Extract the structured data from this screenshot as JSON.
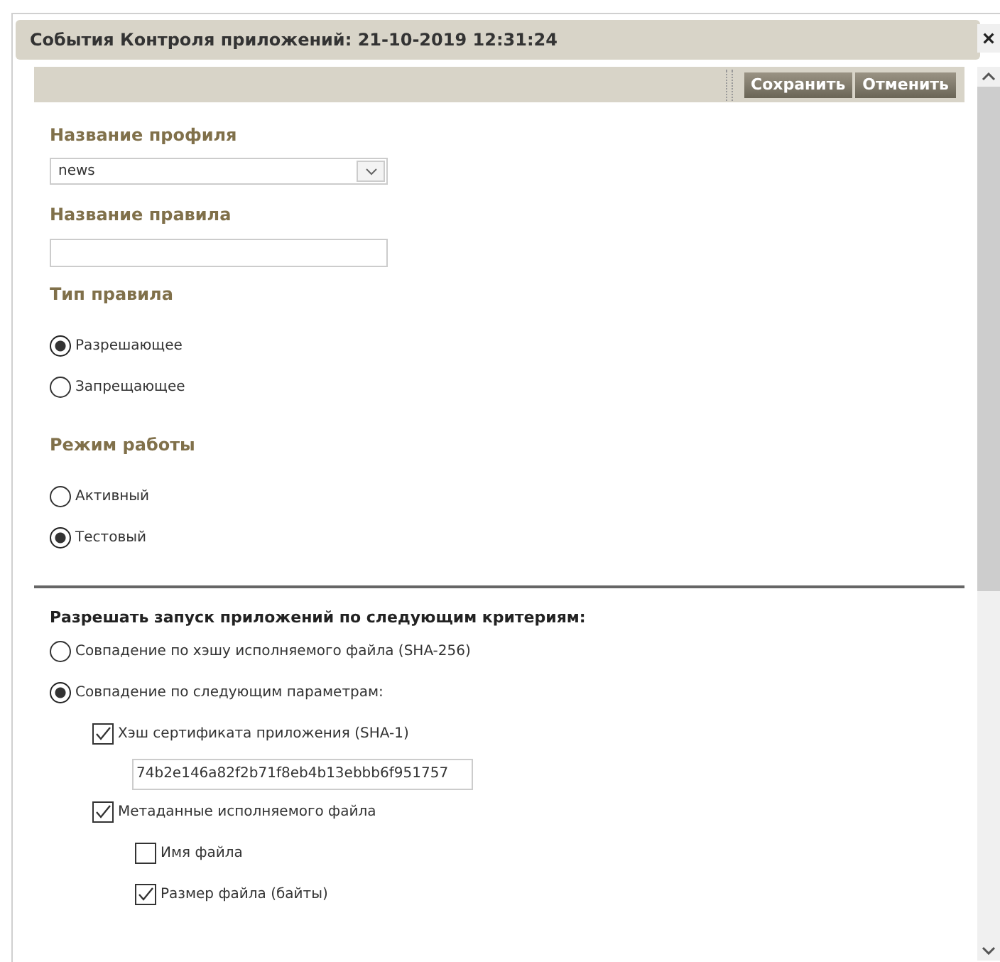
{
  "window": {
    "title": "События Контроля приложений: 21-10-2019 12:31:24",
    "close": "×"
  },
  "toolbar": {
    "buttons": [
      "Сохранить",
      "Отменить"
    ]
  },
  "profile": {
    "label": "Название профиля",
    "value": "news"
  },
  "rule_name": {
    "label": "Название правила"
  },
  "rule_type": {
    "label": "Тип правила",
    "options": [
      {
        "label": "Разрешающее",
        "selected": true
      },
      {
        "label": "Запрещающее",
        "selected": false
      }
    ]
  },
  "mode": {
    "label": "Режим работы",
    "options": [
      {
        "label": "Активный",
        "selected": false
      },
      {
        "label": "Тестовый",
        "selected": true
      }
    ]
  },
  "criteria": {
    "heading": "Разрешать запуск приложений по следующим критериям:",
    "options": [
      {
        "label": "Совпадение по хэшу исполняемого файла (SHA-256)",
        "selected": false
      },
      {
        "label": "Совпадение по следующим параметрам:",
        "selected": true
      }
    ],
    "params": [
      {
        "label": "Хэш сертификата приложения (SHA-1)",
        "checked": true,
        "value": "74b2e146a82f2b71f8eb4b13ebbb6f951757"
      },
      {
        "label": "Метаданные исполняемого файла",
        "checked": true,
        "children": [
          {
            "label": "Имя файла",
            "checked": false
          },
          {
            "label": "Размер файла (байты)",
            "checked": true
          }
        ]
      }
    ]
  }
}
